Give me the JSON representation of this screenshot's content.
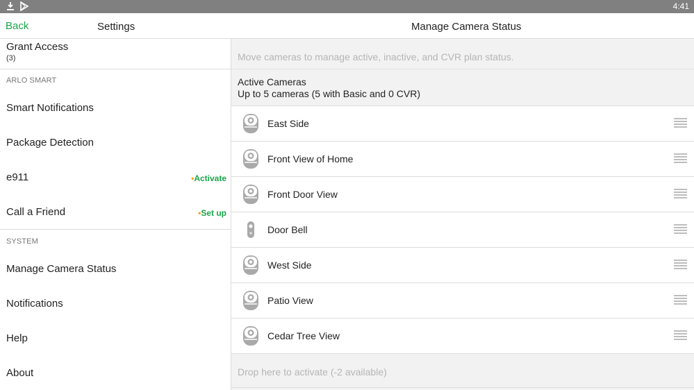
{
  "status_bar": {
    "time": "4:41",
    "icons": [
      "download-icon",
      "play-store-icon"
    ]
  },
  "top_bar": {
    "back_label": "Back",
    "left_title": "Settings",
    "right_title": "Manage Camera Status"
  },
  "left_menu": {
    "grant_access": {
      "label": "Grant Access",
      "count": "(3)"
    },
    "sections": [
      {
        "header": "ARLO SMART",
        "items": [
          {
            "label": "Smart Notifications",
            "action": ""
          },
          {
            "label": "Package Detection",
            "action": ""
          },
          {
            "label": "e911",
            "action": "Activate"
          },
          {
            "label": "Call a Friend",
            "action": "Set up"
          }
        ]
      },
      {
        "header": "SYSTEM",
        "items": [
          {
            "label": "Manage Camera Status",
            "action": ""
          },
          {
            "label": "Notifications",
            "action": ""
          },
          {
            "label": "Help",
            "action": ""
          },
          {
            "label": "About",
            "action": ""
          }
        ]
      }
    ]
  },
  "main": {
    "hint": "Move cameras to manage active, inactive, and CVR plan status.",
    "active_section": {
      "title": "Active Cameras",
      "subtitle": "Up to 5 cameras (5 with Basic and 0 CVR)"
    },
    "cameras": [
      {
        "name": "East Side",
        "icon": "camera-icon"
      },
      {
        "name": "Front View of Home",
        "icon": "camera-icon"
      },
      {
        "name": "Front Door View",
        "icon": "camera-icon"
      },
      {
        "name": "Door Bell",
        "icon": "doorbell-icon"
      },
      {
        "name": "West Side",
        "icon": "camera-icon"
      },
      {
        "name": "Patio View",
        "icon": "camera-icon"
      },
      {
        "name": "Cedar Tree View",
        "icon": "camera-icon"
      }
    ],
    "drop_hint": "Drop here to activate (-2 available)"
  },
  "colors": {
    "accent": "#1aa54a",
    "action_dot": "#f5a623",
    "status_bar": "#808080"
  }
}
